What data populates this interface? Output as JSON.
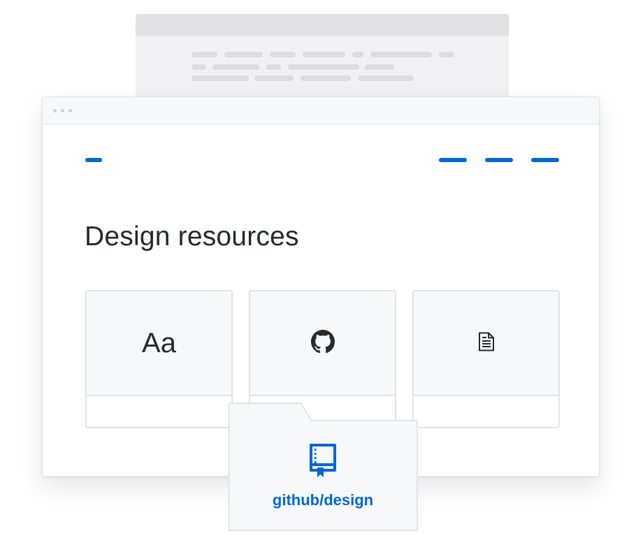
{
  "page": {
    "title": "Design resources"
  },
  "nav": {
    "logo": "logo-placeholder",
    "items": [
      "nav-item-1",
      "nav-item-2",
      "nav-item-3"
    ]
  },
  "cards": [
    {
      "icon": "typography-icon",
      "glyph": "Aa"
    },
    {
      "icon": "github-mark-icon"
    },
    {
      "icon": "document-icon"
    }
  ],
  "repo": {
    "icon": "repo-book-icon",
    "label": "github/design"
  },
  "colors": {
    "accent": "#0366d6",
    "text": "#24292e",
    "border": "#e1e4e8",
    "surface": "#f6f8fa"
  }
}
